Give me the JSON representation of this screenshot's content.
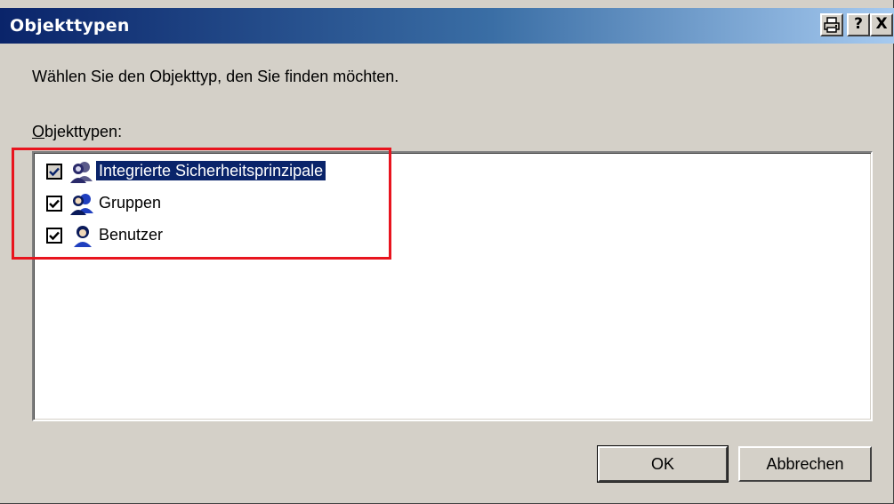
{
  "window": {
    "title": "Objekttypen",
    "titlebar_buttons": {
      "print_icon": "printer-icon",
      "help_label": "?",
      "close_label": "X"
    }
  },
  "dialog": {
    "description": "Wählen Sie den Objekttyp, den Sie finden möchten.",
    "list_label_accel": "O",
    "list_label_rest": "bjekttypen:"
  },
  "object_types": [
    {
      "label": "Integrierte Sicherheitsprinzipale",
      "checked": true,
      "selected": true,
      "icon": "security-principals-icon"
    },
    {
      "label": "Gruppen",
      "checked": true,
      "selected": false,
      "icon": "group-icon"
    },
    {
      "label": "Benutzer",
      "checked": true,
      "selected": false,
      "icon": "user-icon"
    }
  ],
  "buttons": {
    "ok_label": "OK",
    "cancel_label": "Abbrechen"
  },
  "colors": {
    "titlebar_start": "#0a246a",
    "titlebar_end": "#a6caf0",
    "selection": "#0a246a",
    "annotation_box": "#e8141e"
  }
}
